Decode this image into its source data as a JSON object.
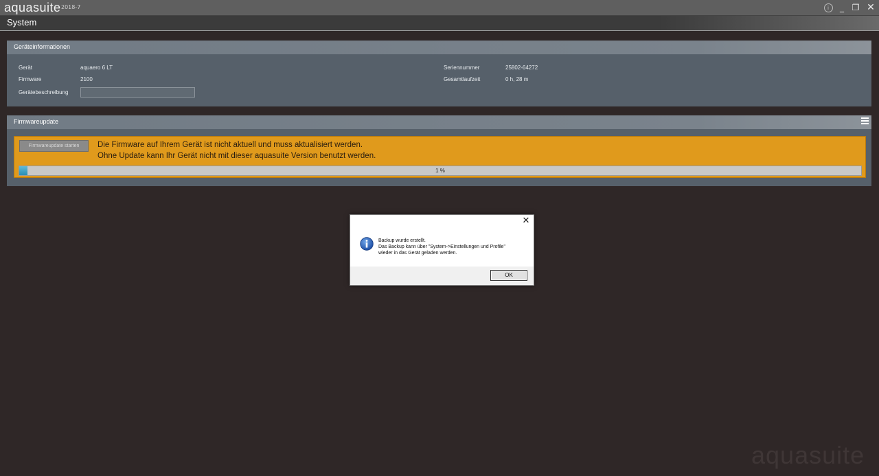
{
  "app": {
    "name": "aquasuite",
    "version": "2018-7"
  },
  "window": {
    "info": "i",
    "minimize": "_",
    "maximize": "❐",
    "close": "✕"
  },
  "page": {
    "title": "System"
  },
  "device_info": {
    "title": "Geräteinformationen",
    "device_label": "Gerät",
    "device_value": "aquaero 6 LT",
    "firmware_label": "Firmware",
    "firmware_value": "2100",
    "description_label": "Gerätebeschreibung",
    "description_value": "",
    "serial_label": "Seriennummer",
    "serial_value": "25802-64272",
    "runtime_label": "Gesamtlaufzeit",
    "runtime_value": "0 h, 28 m"
  },
  "firmware_update": {
    "title": "Firmwareupdate",
    "start_button": "Firmwareupdate starten",
    "message_line1": "Die Firmware auf Ihrem Gerät ist nicht aktuell und muss aktualisiert werden.",
    "message_line2": "Ohne Update kann Ihr Gerät nicht mit dieser aquasuite Version benutzt werden.",
    "progress_percent": 1,
    "progress_text": "1 %"
  },
  "dialog": {
    "line1": "Backup wurde erstellt.",
    "line2": "Das Backup kann über \"System->Einstellungen und Profile\"",
    "line3": "wieder in das Gerät geladen werden.",
    "ok": "OK",
    "close": "✕"
  },
  "watermark": "aquasuite",
  "colors": {
    "background": "#2f2727",
    "panel": "#56606a",
    "warning": "#e09a1c",
    "progress": "#2a8fb5"
  }
}
